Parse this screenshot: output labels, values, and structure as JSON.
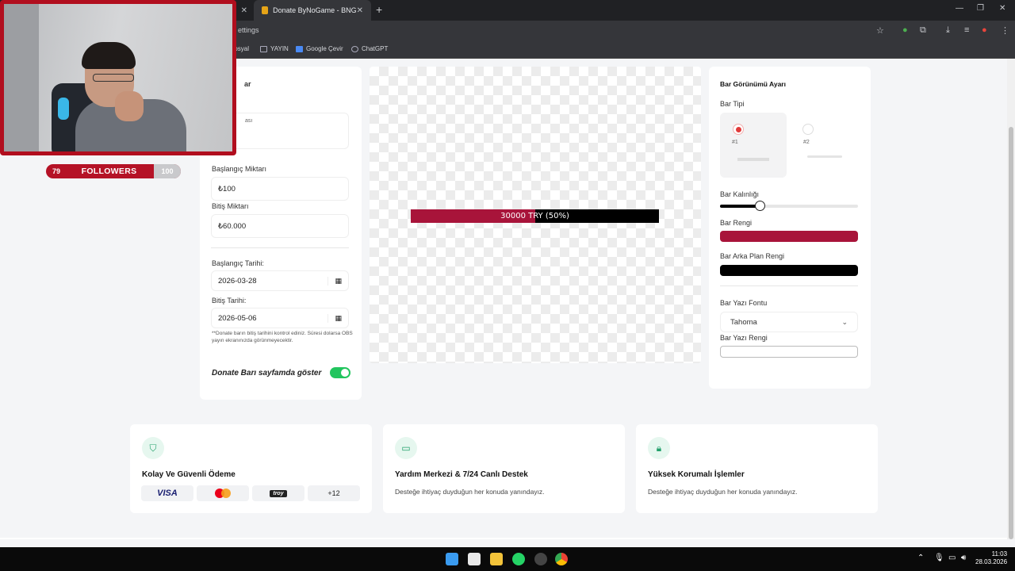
{
  "browser": {
    "tab_active_title": "Donate ByNoGame - BNG Strea",
    "url_fragment": "ettings",
    "bookmarks": [
      "Sosyal",
      "YAYIN",
      "Google Çevir",
      "ChatGPT"
    ]
  },
  "webcam": {
    "followers_current": "79",
    "followers_label": "FOLLOWERS",
    "followers_goal": "100"
  },
  "left_panel": {
    "title_fragment": "ar",
    "textarea_fragment": "ası",
    "start_amount_label": "Başlangıç Miktarı",
    "start_amount_value": "₺100",
    "end_amount_label": "Bitiş Miktarı",
    "end_amount_value": "₺60.000",
    "start_date_label": "Başlangıç Tarihi:",
    "start_date_value": "2026-03-28",
    "end_date_label": "Bitiş Tarihi:",
    "end_date_value": "2026-05-06",
    "note": "**Donate barın bitiş tarihini kontrol ediniz. Süresi dolarsa OBS yayın ekranınızda görünmeyecektir.",
    "toggle_label": "Donate Barı sayfamda göster",
    "toggle_on": true
  },
  "preview": {
    "bar_text": "30000 TRY (50%)",
    "progress": 0.5,
    "fill_color": "#a8143a",
    "bg_color": "#000000"
  },
  "right_panel": {
    "title": "Bar Görünümü Ayarı",
    "bar_type_label": "Bar Tipi",
    "type1_label": "#1",
    "type2_label": "#2",
    "selected_type": "#1",
    "thickness_label": "Bar Kalınlığı",
    "thickness_level": 0.29,
    "bar_color_label": "Bar Rengi",
    "bar_color": "#a8143a",
    "bar_bg_color_label": "Bar Arka Plan Rengi",
    "bar_bg_color": "#000000",
    "font_label": "Bar Yazı Fontu",
    "font_value": "Tahoma",
    "text_color_label": "Bar Yazı Rengi"
  },
  "features": [
    {
      "title": "Kolay Ve Güvenli Ödeme",
      "icon": "shield-check-icon"
    },
    {
      "title": "Yardım Merkezi & 7/24 Canlı Destek",
      "desc": "Desteğe ihtiyaç duyduğun her konuda yanındayız.",
      "icon": "chat-icon"
    },
    {
      "title": "Yüksek Korumalı İşlemler",
      "desc": "Desteğe ihtiyaç duyduğun her konuda yanındayız.",
      "icon": "lock-icon"
    }
  ],
  "payments": [
    "VISA",
    "troy",
    "+12"
  ],
  "taskbar": {
    "time": "11:03",
    "date": "28.03.2026"
  }
}
